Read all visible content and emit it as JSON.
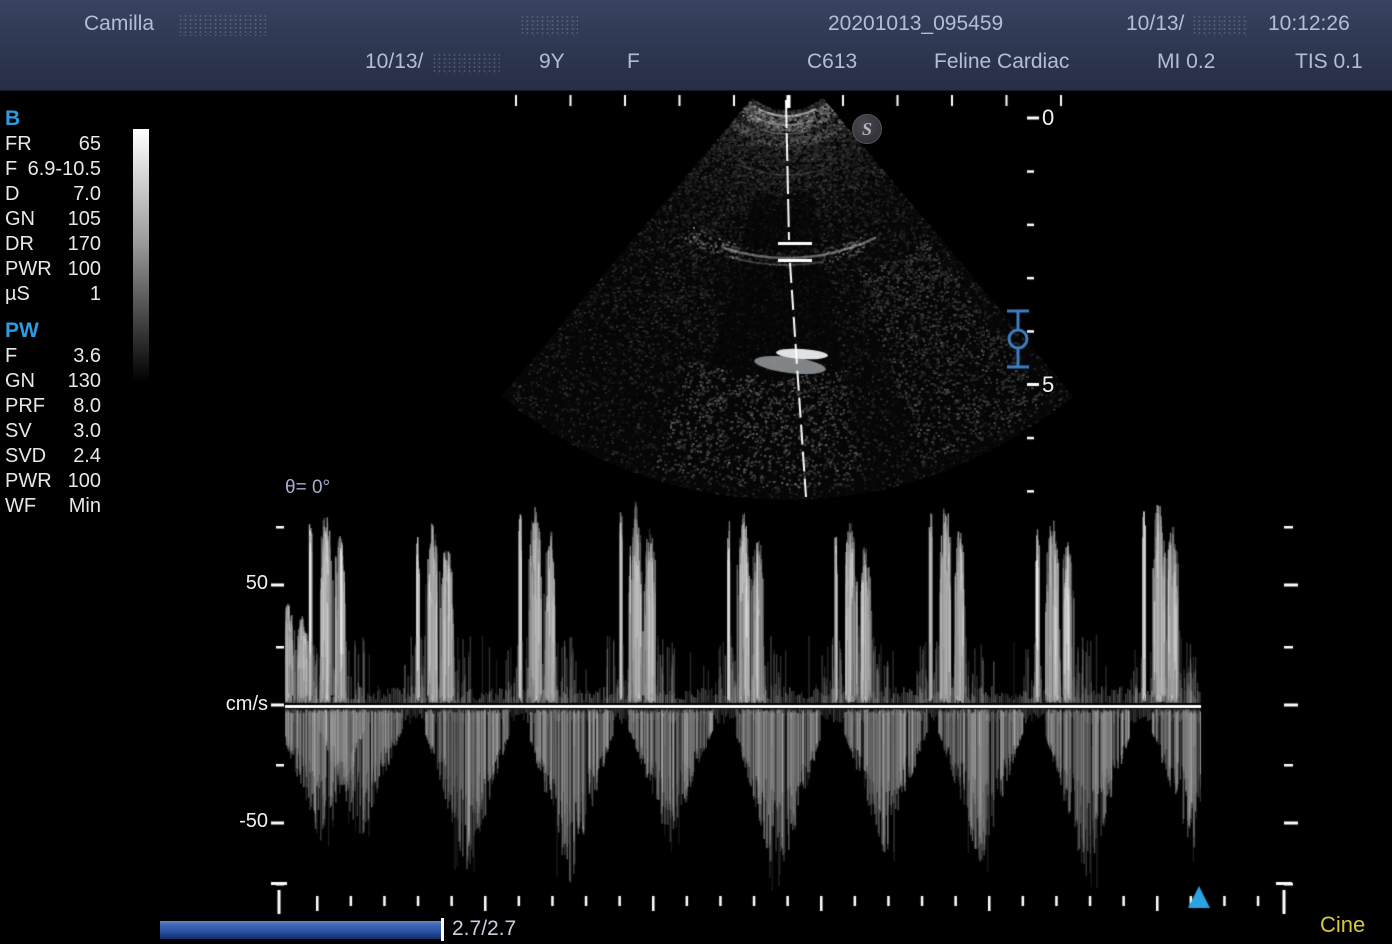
{
  "header": {
    "row1": {
      "patient_name": "Camilla",
      "exam_id": "20201013_095459",
      "date_prefix": "10/13/",
      "time": "10:12:26"
    },
    "row2": {
      "study_date_prefix": "10/13/",
      "age": "9Y",
      "sex": "F",
      "probe": "C613",
      "preset": "Feline Cardiac",
      "mi": "MI 0.2",
      "tis": "TIS 0.1"
    }
  },
  "b_mode": {
    "title": "B",
    "params": [
      {
        "label": "FR",
        "value": "65"
      },
      {
        "label": "F",
        "value": "6.9-10.5"
      },
      {
        "label": "D",
        "value": "7.0"
      },
      {
        "label": "GN",
        "value": "105"
      },
      {
        "label": "DR",
        "value": "170"
      },
      {
        "label": "PWR",
        "value": "100"
      },
      {
        "label": "µS",
        "value": "1"
      }
    ]
  },
  "pw_mode": {
    "title": "PW",
    "params": [
      {
        "label": "F",
        "value": "3.6"
      },
      {
        "label": "GN",
        "value": "130"
      },
      {
        "label": "PRF",
        "value": "8.0"
      },
      {
        "label": "SV",
        "value": "3.0"
      },
      {
        "label": "SVD",
        "value": "2.4"
      },
      {
        "label": "PWR",
        "value": "100"
      },
      {
        "label": "WF",
        "value": "Min"
      }
    ]
  },
  "image_area": {
    "logo": "S",
    "angle_label": "θ= 0°",
    "depth_labels": [
      "0",
      "5"
    ],
    "depth_cm_ticks": [
      0,
      1,
      2,
      3,
      4,
      5,
      6,
      7
    ]
  },
  "spectrum": {
    "scale": {
      "upper": "50",
      "unit": "cm/s",
      "lower": "-50"
    },
    "velocity_ticks_cm_s": [
      75,
      50,
      25,
      0,
      -25,
      -50,
      -75
    ]
  },
  "footer": {
    "progress_value": "2.7/2.7",
    "cine_label": "Cine"
  },
  "colors": {
    "header_bg": "#2e3750",
    "header_text": "#b4bcda",
    "mode_title_blue": "#2f9be0",
    "gate_marker_blue": "#3d7fc4",
    "sweep_triangle_blue": "#2aa3e2",
    "cine_yellow": "#d6c53e",
    "progress_blue": "#2d55a6"
  }
}
